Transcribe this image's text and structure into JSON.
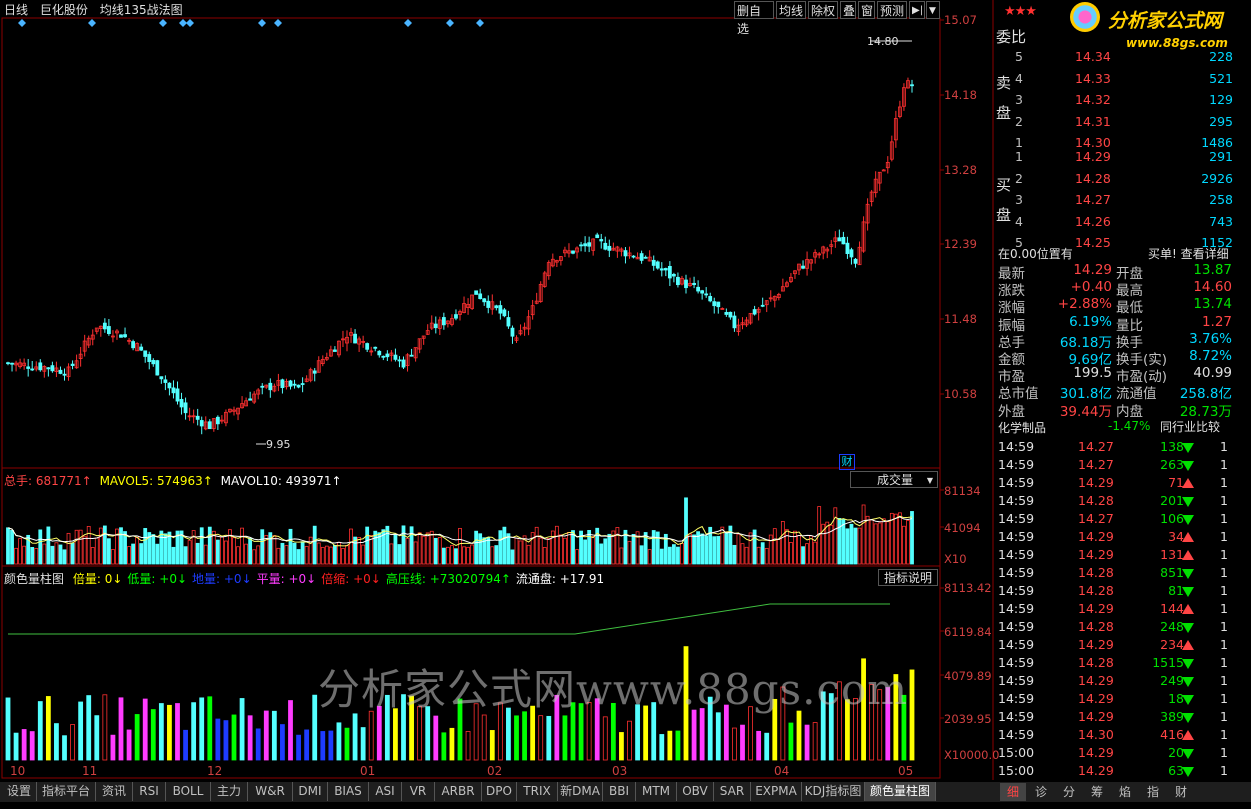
{
  "header": {
    "period": "日线",
    "stock_name": "巨化股份",
    "indicator": "均线135战法图"
  },
  "toolbar": [
    "删自选",
    "均线",
    "除权",
    "叠",
    "窗",
    "预测",
    "▶|",
    "▼"
  ],
  "price_axis": [
    "15.07",
    "14.18",
    "13.28",
    "12.39",
    "11.48",
    "10.58"
  ],
  "annotations": {
    "high": "14.80",
    "low": "9.95",
    "cai": "财"
  },
  "volume_panel": {
    "label_total": "总手: 681771↑",
    "label_ma5": "MAVOL5: 574963↑",
    "label_ma10": "MAVOL10: 493971↑",
    "dropdown": "成交量",
    "axis": [
      "81134",
      "41094"
    ],
    "unit": "X10"
  },
  "indicator_panel": {
    "title": "颜色量柱图",
    "items": [
      {
        "text": "倍量: 0↓",
        "color": "#ffff00"
      },
      {
        "text": "低量: +0↓",
        "color": "#00ff00"
      },
      {
        "text": "地量: +0↓",
        "color": "#1e3cff"
      },
      {
        "text": "平量: +0↓",
        "color": "#ff3cff"
      },
      {
        "text": "倍缩: +0↓",
        "color": "#ff2020"
      },
      {
        "text": "高压线: +73020794↑",
        "color": "#00ff00"
      },
      {
        "text": "流通盘: +17.91",
        "color": "#ffffff"
      }
    ],
    "button": "指标说明",
    "axis": [
      "8113.42",
      "6119.84",
      "4079.89",
      "2039.95"
    ],
    "unit": "X10000.0"
  },
  "watermark": "分析家公式网www.88gs.com",
  "x_axis": [
    {
      "label": "10",
      "pos": 10
    },
    {
      "label": "11",
      "pos": 82
    },
    {
      "label": "12",
      "pos": 207
    },
    {
      "label": "01",
      "pos": 360
    },
    {
      "label": "02",
      "pos": 487
    },
    {
      "label": "03",
      "pos": 612
    },
    {
      "label": "04",
      "pos": 774
    },
    {
      "label": "05",
      "pos": 898
    }
  ],
  "right_panel": {
    "brand": "分析家公式网",
    "brand_url": "www.88gs.com",
    "weibi": "委比",
    "sell_label": [
      "卖",
      "盘"
    ],
    "buy_label": [
      "买",
      "盘"
    ],
    "sell": [
      {
        "lv": "5",
        "price": "14.34",
        "vol": "228"
      },
      {
        "lv": "4",
        "price": "14.33",
        "vol": "521"
      },
      {
        "lv": "3",
        "price": "14.32",
        "vol": "129"
      },
      {
        "lv": "2",
        "price": "14.31",
        "vol": "295"
      },
      {
        "lv": "1",
        "price": "14.30",
        "vol": "1486"
      }
    ],
    "buy": [
      {
        "lv": "1",
        "price": "14.29",
        "vol": "291"
      },
      {
        "lv": "2",
        "price": "14.28",
        "vol": "2926"
      },
      {
        "lv": "3",
        "price": "14.27",
        "vol": "258"
      },
      {
        "lv": "4",
        "price": "14.26",
        "vol": "743"
      },
      {
        "lv": "5",
        "price": "14.25",
        "vol": "1152"
      }
    ],
    "position": "在0.00位置有",
    "buy_link": "买单! 查看详细",
    "quotes": [
      {
        "l1": "最新",
        "v1": "14.29",
        "c1": "#ff4545",
        "l2": "开盘",
        "v2": "13.87",
        "c2": "#00e000"
      },
      {
        "l1": "涨跌",
        "v1": "+0.40",
        "c1": "#ff4545",
        "l2": "最高",
        "v2": "14.60",
        "c2": "#ff4545"
      },
      {
        "l1": "涨幅",
        "v1": "+2.88%",
        "c1": "#ff4545",
        "l2": "最低",
        "v2": "13.74",
        "c2": "#00e000"
      },
      {
        "l1": "振幅",
        "v1": "6.19%",
        "c1": "#00d8ff",
        "l2": "量比",
        "v2": "1.27",
        "c2": "#ff4545"
      },
      {
        "l1": "总手",
        "v1": "68.18万",
        "c1": "#00d8ff",
        "l2": "换手",
        "v2": "3.76%",
        "c2": "#00d8ff"
      },
      {
        "l1": "金额",
        "v1": "9.69亿",
        "c1": "#00d8ff",
        "l2": "换手(实)",
        "v2": "8.72%",
        "c2": "#00d8ff"
      },
      {
        "l1": "市盈",
        "v1": "199.5",
        "c1": "#e0e0e0",
        "l2": "市盈(动)",
        "v2": "40.99",
        "c2": "#e0e0e0"
      },
      {
        "l1": "总市值",
        "v1": "301.8亿",
        "c1": "#00d8ff",
        "l2": "流通值",
        "v2": "258.8亿",
        "c2": "#00d8ff"
      },
      {
        "l1": "外盘",
        "v1": "39.44万",
        "c1": "#ff4545",
        "l2": "内盘",
        "v2": "28.73万",
        "c2": "#00e000"
      }
    ],
    "industry": "化学制品",
    "industry_change": "-1.47%",
    "industry_btn": "同行业比较",
    "ticks": [
      {
        "t": "14:59",
        "p": "14.27",
        "v": "138",
        "d": "down"
      },
      {
        "t": "14:59",
        "p": "14.27",
        "v": "263",
        "d": "down"
      },
      {
        "t": "14:59",
        "p": "14.29",
        "v": "71",
        "d": "up"
      },
      {
        "t": "14:59",
        "p": "14.28",
        "v": "201",
        "d": "down"
      },
      {
        "t": "14:59",
        "p": "14.27",
        "v": "106",
        "d": "down"
      },
      {
        "t": "14:59",
        "p": "14.29",
        "v": "34",
        "d": "up"
      },
      {
        "t": "14:59",
        "p": "14.29",
        "v": "131",
        "d": "up"
      },
      {
        "t": "14:59",
        "p": "14.28",
        "v": "851",
        "d": "down"
      },
      {
        "t": "14:59",
        "p": "14.28",
        "v": "81",
        "d": "down"
      },
      {
        "t": "14:59",
        "p": "14.29",
        "v": "144",
        "d": "up"
      },
      {
        "t": "14:59",
        "p": "14.28",
        "v": "248",
        "d": "down"
      },
      {
        "t": "14:59",
        "p": "14.29",
        "v": "234",
        "d": "up"
      },
      {
        "t": "14:59",
        "p": "14.28",
        "v": "1515",
        "d": "down"
      },
      {
        "t": "14:59",
        "p": "14.29",
        "v": "249",
        "d": "down"
      },
      {
        "t": "14:59",
        "p": "14.29",
        "v": "18",
        "d": "down"
      },
      {
        "t": "14:59",
        "p": "14.29",
        "v": "389",
        "d": "down"
      },
      {
        "t": "14:59",
        "p": "14.30",
        "v": "416",
        "d": "up"
      },
      {
        "t": "15:00",
        "p": "14.29",
        "v": "20",
        "d": "down"
      },
      {
        "t": "15:00",
        "p": "14.29",
        "v": "63",
        "d": "down"
      }
    ],
    "tick_right": "1",
    "side_tabs": [
      "细",
      "诊",
      "分",
      "筹",
      "焰",
      "指",
      "财"
    ]
  },
  "bottom_tabs": [
    "设置",
    "指标平台",
    "资讯",
    "RSI",
    "BOLL",
    "主力",
    "W&R",
    "DMI",
    "BIAS",
    "ASI",
    "VR",
    "ARBR",
    "DPO",
    "TRIX",
    "新DMA",
    "BBI",
    "MTM",
    "OBV",
    "SAR",
    "EXPMA",
    "KDJ指标图",
    "颜色量柱图"
  ],
  "colors": {
    "up": "#ff3030",
    "down": "#54ffff",
    "bg": "#000000",
    "grid": "#8b0000"
  }
}
